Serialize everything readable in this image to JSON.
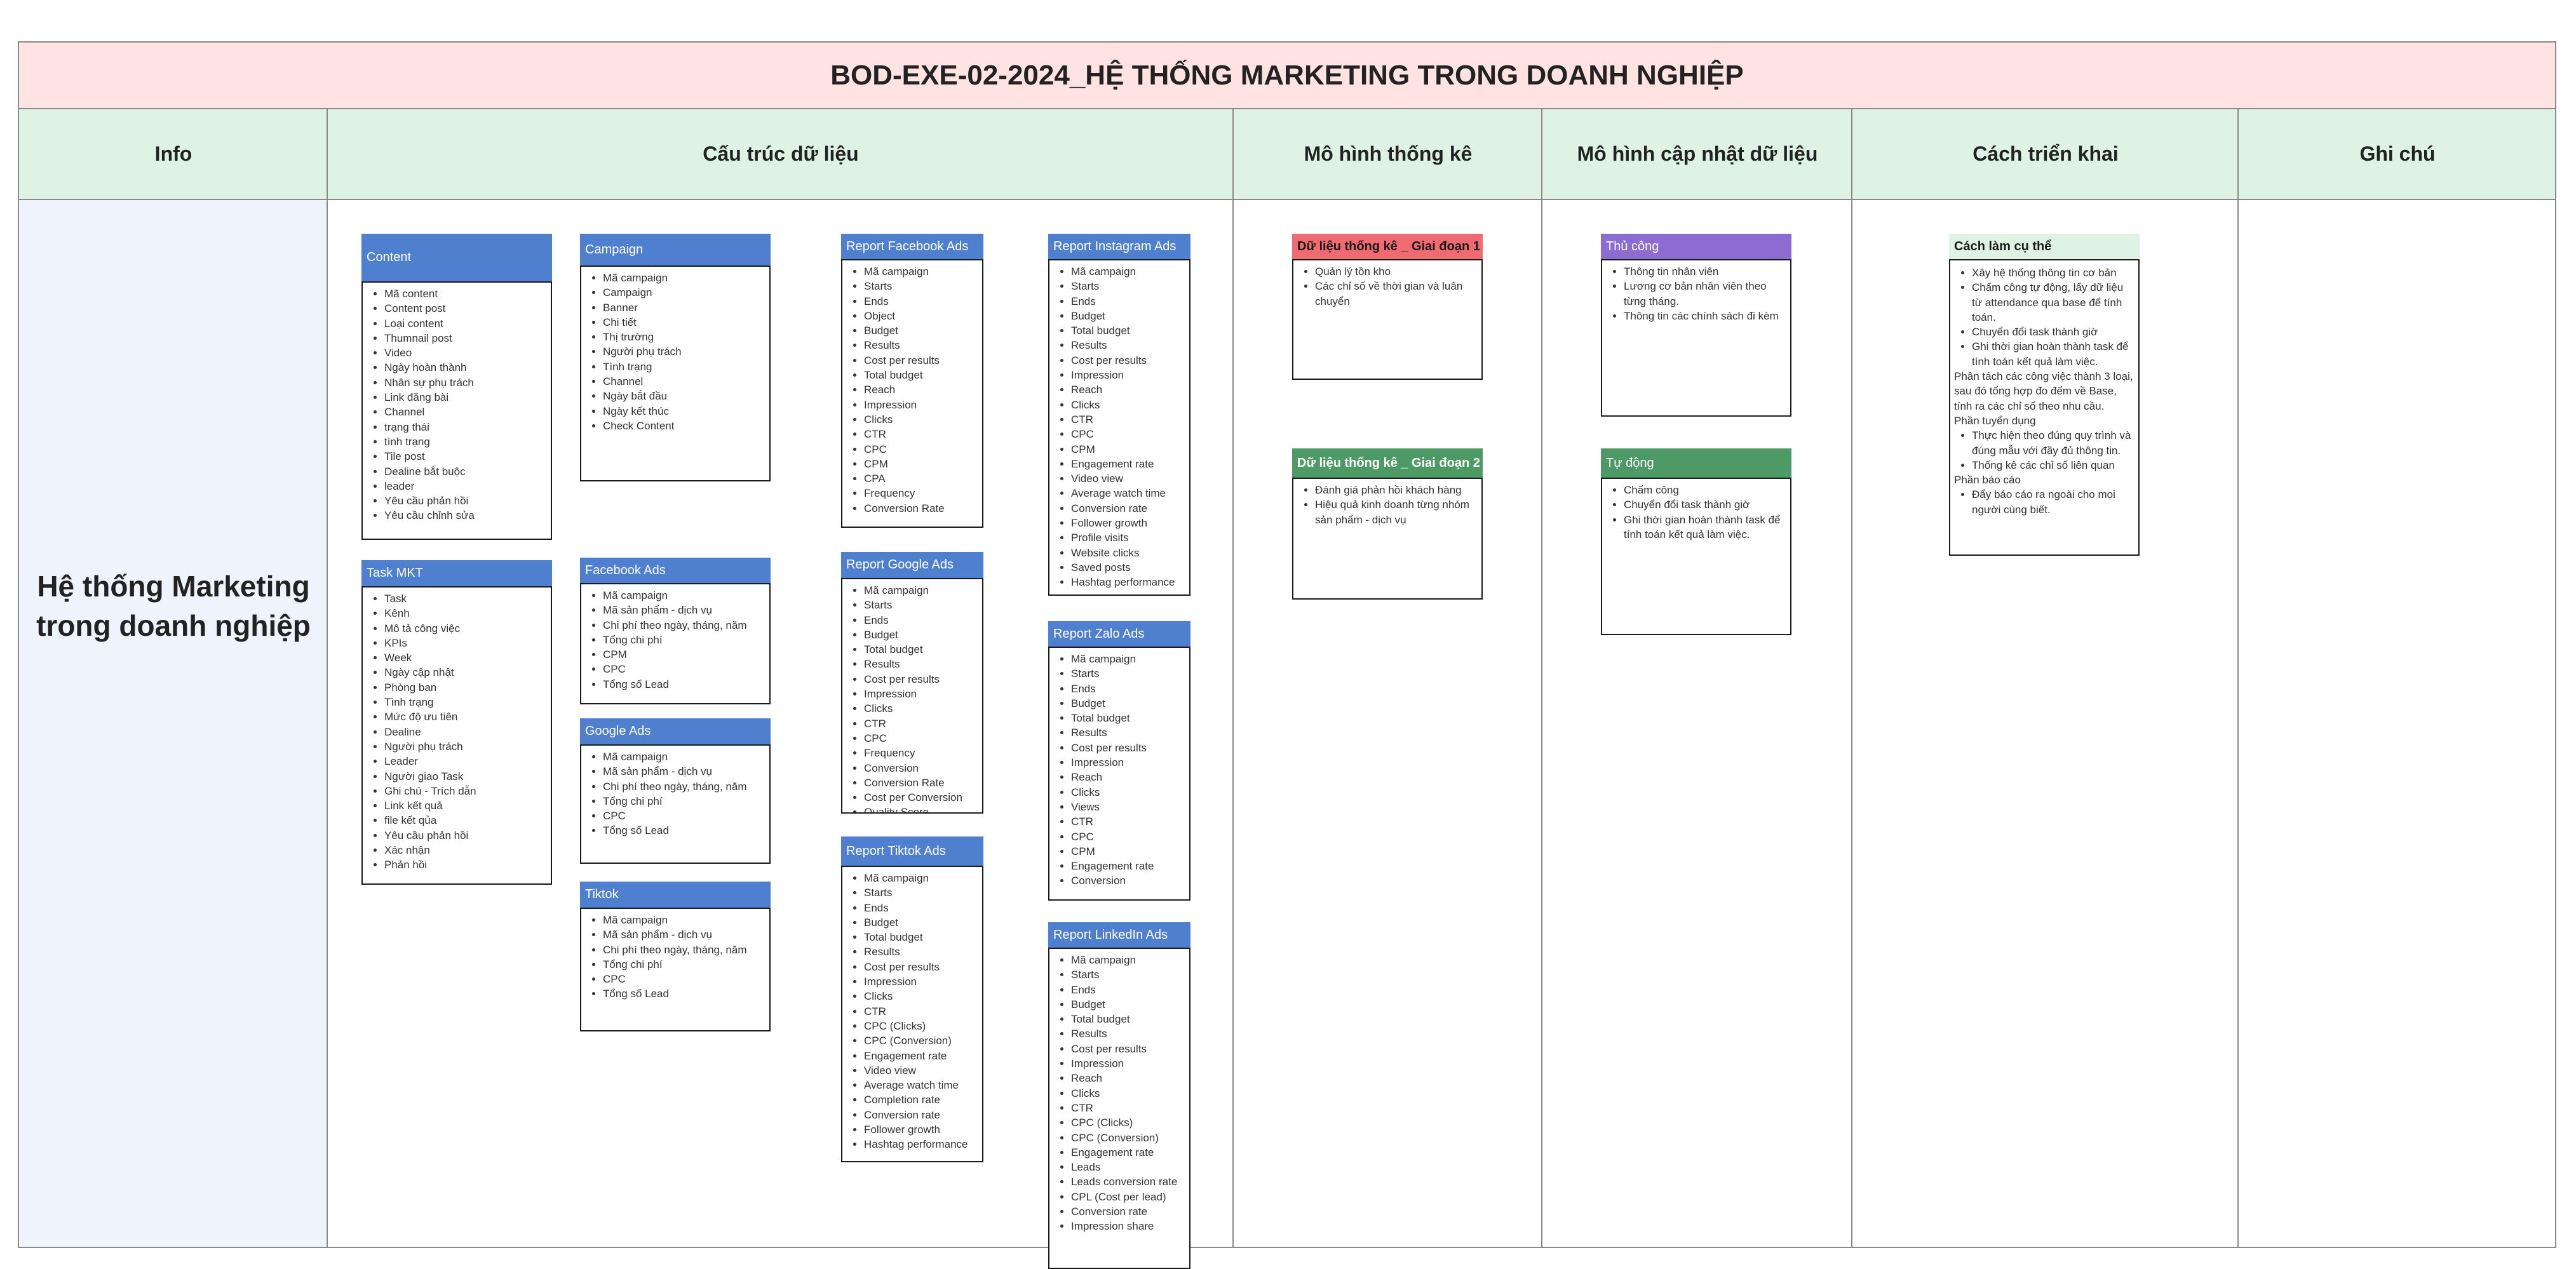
{
  "title": "BOD-EXE-02-2024_HỆ THỐNG MARKETING TRONG DOANH NGHIỆP",
  "headers": {
    "info": "Info",
    "structure": "Cấu trúc dữ liệu",
    "stats_model": "Mô hình thống kê",
    "update_model": "Mô hình cập nhật dữ liệu",
    "deploy": "Cách triển khai",
    "notes": "Ghi chú"
  },
  "info_text": "Hệ thống Marketing trong doanh nghiệp",
  "colors": {
    "title_bg": "#ffe3e3",
    "header_bg": "#dff3e4",
    "info_bg": "#eef3fc",
    "box_blue": "#4f7fcf",
    "box_red": "#f06a72",
    "box_purple": "#8c6cd0",
    "box_green": "#4e9a66"
  },
  "boxes": {
    "content": {
      "title": "Content",
      "items": [
        "Mã content",
        "Content post",
        "Loại content",
        "Thumnail post",
        "Video",
        "Ngày hoàn thành",
        "Nhân sự phụ trách",
        "Link đăng bài",
        "Channel",
        "trạng thái",
        "tình trạng",
        "Tile post",
        "Dealine bắt buộc",
        "leader",
        "Yêu cầu phản hồi",
        "Yêu cầu chỉnh sửa"
      ]
    },
    "task_mkt": {
      "title": "Task MKT",
      "items": [
        "Task",
        "Kênh",
        "Mô tả công việc",
        "KPIs",
        "Week",
        "Ngày cập nhật",
        "Phòng ban",
        "Tình trạng",
        "Mức độ ưu tiên",
        "Dealine",
        "Người phụ trách",
        "Leader",
        "Người giao Task",
        "Ghi chú - Trích dẫn",
        "Link kết quả",
        "file kết qủa",
        "Yêu cầu phản hồi",
        "Xác nhận",
        "Phản hồi"
      ]
    },
    "campaign": {
      "title": "Campaign",
      "items": [
        "Mã campaign",
        "Campaign",
        "Banner",
        "Chi tiết",
        "Thị trường",
        "Người phụ trách",
        "Tình trạng",
        "Channel",
        "Ngày bắt đầu",
        "Ngày kết thúc",
        "Check Content"
      ]
    },
    "facebook_ads": {
      "title": "Facebook Ads",
      "items": [
        "Mã campaign",
        "Mã sản phẩm - dịch vụ",
        "Chi phí theo ngày, tháng, năm",
        "Tổng chi phí",
        "CPM",
        "CPC",
        "Tổng số Lead"
      ]
    },
    "google_ads": {
      "title": "Google Ads",
      "items": [
        "Mã campaign",
        "Mã sản phẩm - dịch vụ",
        "Chi phí theo ngày, tháng, năm",
        "Tổng chi phí",
        "CPC",
        "Tổng số Lead"
      ]
    },
    "tiktok": {
      "title": "Tiktok",
      "items": [
        "Mã campaign",
        "Mã sản phẩm - dịch vụ",
        "Chi phí theo ngày, tháng, năm",
        "Tổng chi phí",
        "CPC",
        "Tổng số Lead"
      ]
    },
    "report_facebook": {
      "title": "Report Facebook Ads",
      "items": [
        "Mã campaign",
        "Starts",
        "Ends",
        "Object",
        "Budget",
        "Results",
        "Cost per results",
        "Total budget",
        "Reach",
        "Impression",
        "Clicks",
        "CTR",
        "CPC",
        "CPM",
        "CPA",
        "Frequency",
        "Conversion Rate"
      ]
    },
    "report_google": {
      "title": "Report Google Ads",
      "items": [
        "Mã campaign",
        "Starts",
        "Ends",
        "Budget",
        "Total budget",
        "Results",
        "Cost per results",
        "Impression",
        "Clicks",
        "CTR",
        "CPC",
        "Frequency",
        "Conversion",
        "Conversion Rate",
        "Cost per Conversion",
        "Quality Score"
      ]
    },
    "report_tiktok": {
      "title": "Report Tiktok Ads",
      "items": [
        "Mã campaign",
        "Starts",
        "Ends",
        "Budget",
        "Total budget",
        "Results",
        "Cost per results",
        "Impression",
        "Clicks",
        "CTR",
        "CPC (Clicks)",
        "CPC (Conversion)",
        "Engagement rate",
        "Video view",
        "Average watch time",
        "Completion rate",
        "Conversion rate",
        "Follower growth",
        "Hashtag performance"
      ]
    },
    "report_instagram": {
      "title": "Report Instagram Ads",
      "items": [
        "Mã campaign",
        "Starts",
        "Ends",
        "Budget",
        "Total budget",
        "Results",
        "Cost per results",
        "Impression",
        "Reach",
        "Clicks",
        "CTR",
        "CPC",
        "CPM",
        "Engagement rate",
        "Video view",
        "Average watch time",
        "Conversion rate",
        "Follower growth",
        "Profile visits",
        "Website clicks",
        "Saved posts",
        "Hashtag performance"
      ]
    },
    "report_zalo": {
      "title": "Report Zalo Ads",
      "items": [
        "Mã campaign",
        "Starts",
        "Ends",
        "Budget",
        "Total budget",
        "Results",
        "Cost per results",
        "Impression",
        "Reach",
        "Clicks",
        "Views",
        "CTR",
        "CPC",
        "CPM",
        "Engagement rate",
        "Conversion"
      ]
    },
    "report_linkedin": {
      "title": "Report LinkedIn Ads",
      "items": [
        "Mã campaign",
        "Starts",
        "Ends",
        "Budget",
        "Total budget",
        "Results",
        "Cost per results",
        "Impression",
        "Reach",
        "Clicks",
        "CTR",
        "CPC (Clicks)",
        "CPC (Conversion)",
        "Engagement rate",
        "Leads",
        "Leads conversion rate",
        "CPL (Cost per lead)",
        "Conversion rate",
        "Impression share"
      ]
    },
    "stats_phase1": {
      "title": "Dữ liệu thống kê _ Giai đoạn 1",
      "items": [
        "Quản lý tồn kho",
        "Các chỉ số về thời gian và luân chuyển"
      ]
    },
    "stats_phase2": {
      "title": "Dữ liệu thống kê _ Giai đoạn 2",
      "items": [
        "Đánh giá phản hồi khách hàng",
        "Hiệu quả kinh doanh từng nhóm sản phẩm - dịch vụ"
      ]
    },
    "manual": {
      "title": "Thủ công",
      "items": [
        "Thông tin nhân viên",
        "Lương cơ bản nhân viên theo từng tháng.",
        "Thông tin các chính sách đi kèm"
      ]
    },
    "automatic": {
      "title": "Tự động",
      "items": [
        "Chấm công",
        "Chuyển đổi task thành giờ",
        "Ghi thời gian hoàn thành task để tính toán  kết quả làm việc."
      ]
    },
    "howto": {
      "title": "Cách làm cụ thể",
      "list1": [
        "Xây hệ thống thông tin cơ bản",
        "Chấm công tự động, lấy dữ liệu từ attendance qua base để tính toán.",
        "Chuyển đổi task thành giờ",
        "Ghi thời gian hoàn thành task để tính toán  kết quả làm việc."
      ],
      "para1": "Phân tách các công việc thành 3 loại, sau đó tổng hợp đo đếm về Base, tính ra các chỉ số theo nhu cầu.",
      "para2": "Phần tuyển dụng",
      "list2": [
        "Thực hiện theo đúng quy trình và đúng mẫu với đầy đủ thông tin.",
        "Thống kê các chỉ số liên quan"
      ],
      "para3": "Phần báo cáo",
      "list3": [
        "Đẩy báo cáo ra ngoài cho mọi người cùng biết."
      ]
    }
  }
}
